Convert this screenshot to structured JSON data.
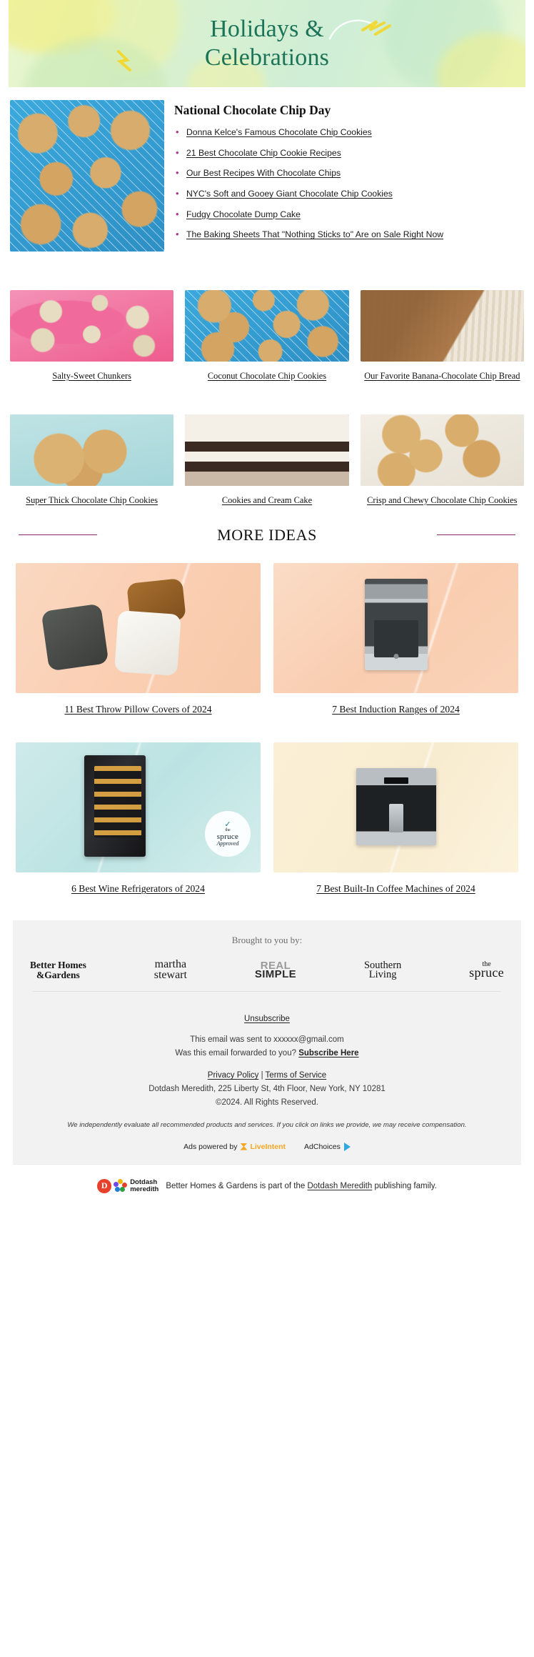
{
  "hero": {
    "title_line1": "Holidays &",
    "title_line2": "Celebrations",
    "accent_color": "#1b7358"
  },
  "feature": {
    "image_alt": "chocolate-chip-cookies-on-blue-cloth",
    "title": "National Chocolate Chip Day",
    "links": [
      "Donna Kelce's Famous Chocolate Chip Cookies",
      "21 Best Chocolate Chip Cookie Recipes",
      "Our Best Recipes With Chocolate Chips",
      "NYC's Soft and Gooey Giant Chocolate Chip Cookies",
      "Fudgy Chocolate Dump Cake",
      "The Baking Sheets That \"Nothing Sticks to\" Are on Sale Right Now"
    ],
    "bullet_color": "#a43a8e"
  },
  "recipe_rows": [
    {
      "cards": [
        {
          "caption": "Salty-Sweet Chunkers",
          "image_alt": "cookies-on-pink-plates"
        },
        {
          "caption": "Coconut Chocolate Chip Cookies",
          "image_alt": "cookies-on-cooling-rack"
        },
        {
          "caption": "Our Favorite Banana-Chocolate Chip Bread",
          "image_alt": "sliced-banana-bread-with-coffee"
        }
      ]
    },
    {
      "cards": [
        {
          "caption": "Super Thick Chocolate Chip Cookies",
          "image_alt": "stack-of-thick-cookies"
        },
        {
          "caption": "Cookies and Cream Cake",
          "image_alt": "layered-cookies-and-cream-cake"
        },
        {
          "caption": "Crisp and Chewy Chocolate Chip Cookies",
          "image_alt": "crisp-chewy-cookies"
        }
      ]
    }
  ],
  "more_ideas": {
    "title": "MORE IDEAS",
    "rule_color": "#8d2a6e"
  },
  "product_rows": [
    {
      "products": [
        {
          "caption": "11 Best Throw Pillow Covers of 2024",
          "image_alt": "three-boucle-throw-pillows",
          "bg": "#f9d2b6"
        },
        {
          "caption": "7 Best Induction Ranges of 2024",
          "image_alt": "stainless-steel-induction-range",
          "bg": "#fbd5bb"
        }
      ]
    },
    {
      "products": [
        {
          "caption": "6 Best Wine Refrigerators of 2024",
          "image_alt": "black-wine-refrigerator",
          "bg": "#c9e7e7",
          "badge": {
            "line1": "the",
            "line2": "spruce",
            "line3": "Approved"
          }
        },
        {
          "caption": "7 Best Built-In Coffee Machines of 2024",
          "image_alt": "built-in-stainless-coffee-machine",
          "bg": "#faeed4"
        }
      ]
    }
  ],
  "footer": {
    "brought_to_you_by": "Brought to you by:",
    "brands": [
      {
        "name": "better-homes-and-gardens",
        "line1": "Better Homes",
        "line2": "&Gardens"
      },
      {
        "name": "martha-stewart",
        "line1": "martha",
        "line2": "stewart"
      },
      {
        "name": "real-simple",
        "line1": "REAL",
        "line2": "SIMPLE"
      },
      {
        "name": "southern-living",
        "line1": "Southern",
        "line2": "Living"
      },
      {
        "name": "the-spruce",
        "line1": "the",
        "line2": "spruce"
      }
    ],
    "unsubscribe": "Unsubscribe",
    "sent_to": "This email was sent to xxxxxx@gmail.com",
    "forwarded_prefix": "Was this email forwarded to you? ",
    "subscribe_here": "Subscribe Here",
    "privacy_policy": "Privacy Policy",
    "separator": " | ",
    "terms_of_service": "Terms of Service",
    "address": "Dotdash Meredith, 225 Liberty St, 4th Floor, New York, NY 10281",
    "copyright": "©2024. All Rights Reserved.",
    "disclaimer": "We independently evaluate all recommended products and services. If you click on links we provide, we may receive compensation.",
    "ads_powered_by": "Ads powered by",
    "liveintent": "LiveIntent",
    "adchoices": "AdChoices",
    "liveintent_color": "#f5a623",
    "adchoices_color": "#2fa8dd"
  },
  "dotdash_bar": {
    "logo_letter": "D",
    "logo_line1": "Dotdash",
    "logo_line2": "meredith",
    "text_prefix": "Better Homes & Gardens is part of the ",
    "link": "Dotdash Meredith",
    "text_suffix": " publishing family."
  }
}
